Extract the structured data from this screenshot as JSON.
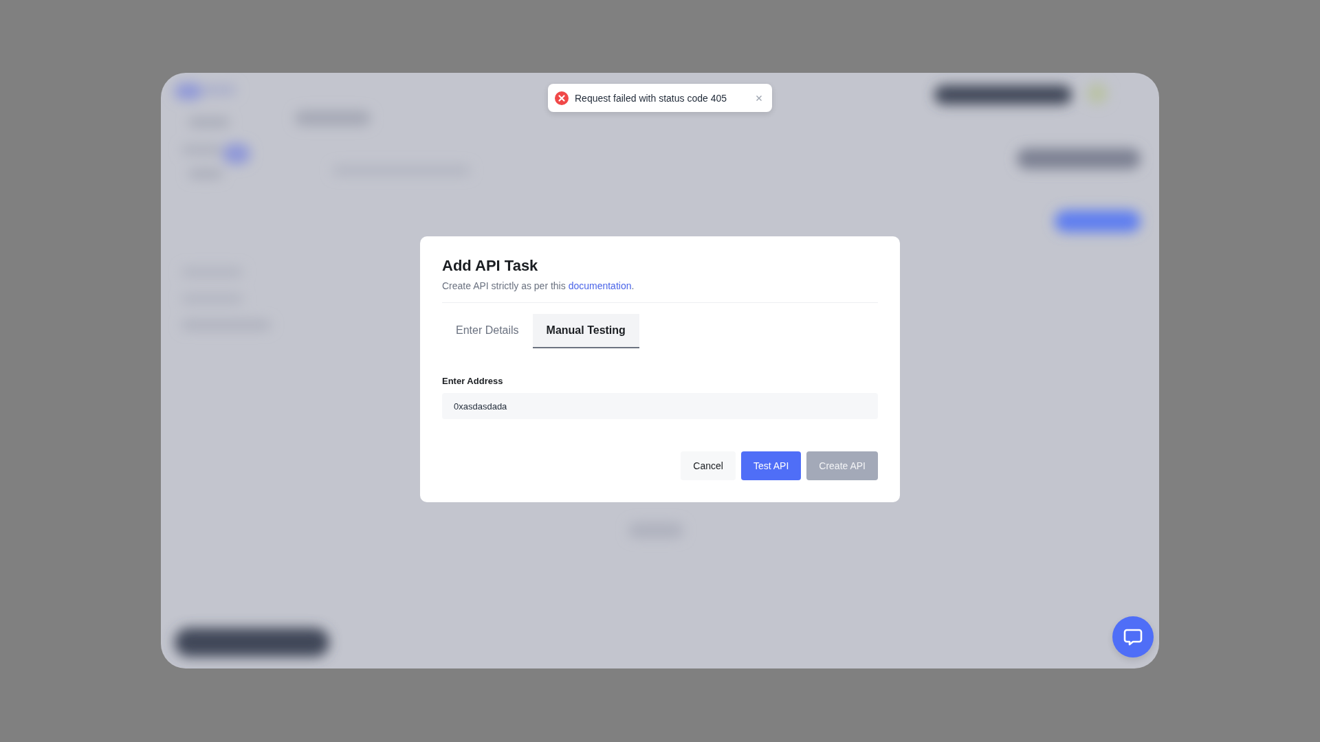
{
  "toast": {
    "message": "Request failed with status code 405"
  },
  "dialog": {
    "title": "Add API Task",
    "subtitle": "Create API strictly as per this ",
    "link": "documentation",
    "subtitle_end": ".",
    "tabs": [
      {
        "label": "Enter Details",
        "selected": false
      },
      {
        "label": "Manual Testing",
        "selected": true
      }
    ],
    "field": {
      "label": "Enter Address",
      "value": "0xasdasdada"
    },
    "buttons": [
      {
        "label": "Cancel",
        "kind": "secondary",
        "disabled": false
      },
      {
        "label": "Test API",
        "kind": "primary",
        "disabled": false
      },
      {
        "label": "Create API",
        "kind": "primary",
        "disabled": true
      }
    ]
  }
}
